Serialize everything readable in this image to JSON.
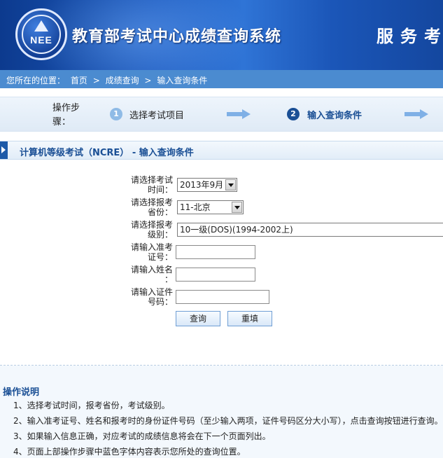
{
  "header": {
    "logo_text": "NEE",
    "site_title": "教育部考试中心成绩查询系统",
    "service_text": "服务考"
  },
  "breadcrumb": {
    "prefix": "您所在的位置：",
    "items": [
      "首页",
      "成绩查询",
      "输入查询条件"
    ],
    "separator": ">"
  },
  "steps": {
    "label": "操作步骤：",
    "items": [
      {
        "number": "1",
        "label": "选择考试项目",
        "active": false
      },
      {
        "number": "2",
        "label": "输入查询条件",
        "active": true
      }
    ]
  },
  "section": {
    "title": "计算机等级考试（NCRE） - 输入查询条件"
  },
  "form": {
    "exam_time": {
      "label_line1": "请选择考试",
      "label_line2": "时间：",
      "value": "2013年9月"
    },
    "province": {
      "label_line1": "请选择报考",
      "label_line2": "省份：",
      "value": "11-北京"
    },
    "level": {
      "label_line1": "请选择报考",
      "label_line2": "级别：",
      "value": "10一级(DOS)(1994-2002上)"
    },
    "ticket_no": {
      "label_line1": "请输入准考",
      "label_line2": "证号：",
      "value": ""
    },
    "name": {
      "label_line1": "请输入姓名",
      "label_line2": "：",
      "value": ""
    },
    "id_no": {
      "label_line1": "请输入证件",
      "label_line2": "号码：",
      "value": ""
    },
    "query_button": "查询",
    "reset_button": "重填"
  },
  "instructions": {
    "title": "操作说明",
    "items": [
      "1、选择考试时间，报考省份，考试级别。",
      "2、输入准考证号、姓名和报考时的身份证件号码（至少输入两项，证件号码区分大小写），点击查询按钮进行查询。",
      "3、如果输入信息正确，对应考试的成绩信息将会在下一个页面列出。",
      "4、页面上部操作步骤中蓝色字体内容表示您所处的查询位置。"
    ]
  },
  "colors": {
    "header_blue": "#1f5cc0",
    "crumb_bar": "#4b8bd0",
    "section_title": "#1a4f95",
    "active_step": "#1a4f95",
    "inactive_step_circle": "#8fbbe6"
  }
}
